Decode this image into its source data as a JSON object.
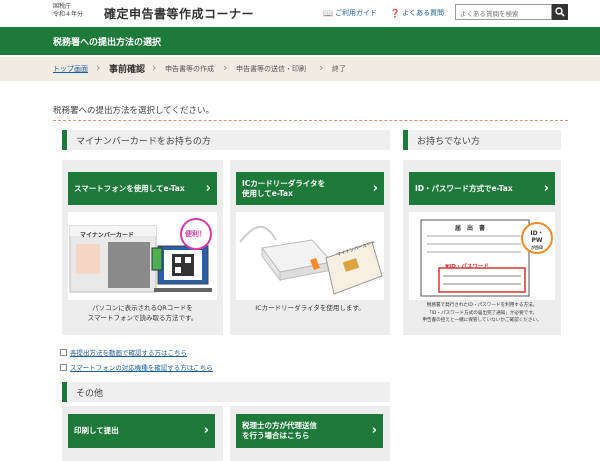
{
  "header": {
    "era_line1": "国税庁",
    "era_line2": "令和４年分",
    "title": "確定申告書等作成コーナー",
    "guide_label": "ご利用ガイド",
    "faq_label": "よくある質問",
    "search_placeholder": "よくある質問を検索"
  },
  "titlebar": {
    "label": "税務署への提出方法の選択"
  },
  "breadcrumb": {
    "top": "トップ画面",
    "current": "事前確認",
    "step3": "申告書等の作成",
    "step4": "申告書等の送信・印刷",
    "step5": "終了"
  },
  "intro": "税務署への提出方法を選択してください。",
  "sections": {
    "mynumber": "マイナンバーカードをお持ちの方",
    "no_card": "お持ちでない方",
    "other": "その他"
  },
  "cards": [
    {
      "button": "スマートフォンを使用してe-Tax",
      "desc": "パソコンに表示されるQRコードを\nスマートフォンで読み取る方法です。",
      "img_card_label": "マイナンバーカード",
      "img_badge": "便利！"
    },
    {
      "button_line1": "ICカードリーダライタを",
      "button_line2": "使用してe-Tax",
      "desc": "ICカードリーダライタを使用します。",
      "img_card_label": "マイナンバーカード"
    },
    {
      "button": "ID・パスワード方式でe-Tax",
      "desc_line1": "税務署で発行されたID・パスワードを利用する方法。",
      "desc_line2": "「ID・パスワード方式の届出完了通知」が必要です。",
      "desc_line3": "申告書の控えと一緒に保管していないかご確認ください。",
      "img_doc_title": "届　出　書",
      "img_badge_line1": "ID・PW",
      "img_badge_line2": "が目印",
      "img_idpw_label": "▼ID・パスワード"
    }
  ],
  "links": [
    "各提出方法を動画で確認する方はこちら",
    "スマートフォンの対応機種を確認する方はこちら"
  ],
  "other_buttons": [
    {
      "label": "印刷して提出"
    },
    {
      "line1": "税理士の方が代理送信",
      "line2": "を行う場合はこちら"
    }
  ],
  "colors": {
    "green": "#1e7a3b",
    "cream": "#f1ece1",
    "link": "#1a5c9e"
  }
}
